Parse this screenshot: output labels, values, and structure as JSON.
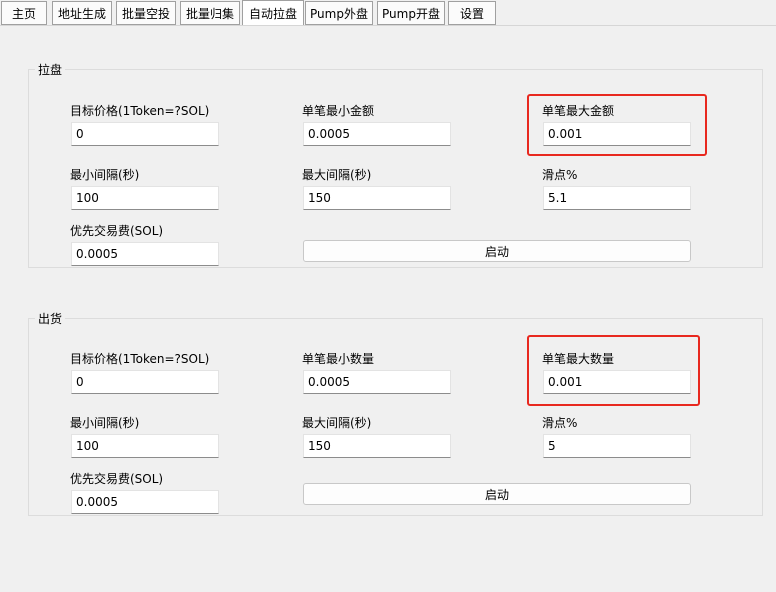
{
  "tabs": [
    "主页",
    "地址生成",
    "批量空投",
    "批量归集",
    "自动拉盘",
    "Pump外盘",
    "Pump开盘",
    "设置"
  ],
  "active_tab": "自动拉盘",
  "pump_group": {
    "title": "拉盘",
    "target_price_label": "目标价格(1Token=?SOL)",
    "target_price_value": "0",
    "min_amount_label": "单笔最小金额",
    "min_amount_value": "0.0005",
    "max_amount_label": "单笔最大金额",
    "max_amount_value": "0.001",
    "min_interval_label": "最小间隔(秒)",
    "min_interval_value": "100",
    "max_interval_label": "最大间隔(秒)",
    "max_interval_value": "150",
    "slippage_label": "滑点%",
    "slippage_value": "5.1",
    "priority_fee_label": "优先交易费(SOL)",
    "priority_fee_value": "0.0005",
    "start_button": "启动"
  },
  "sell_group": {
    "title": "出货",
    "target_price_label": "目标价格(1Token=?SOL)",
    "target_price_value": "0",
    "min_qty_label": "单笔最小数量",
    "min_qty_value": "0.0005",
    "max_qty_label": "单笔最大数量",
    "max_qty_value": "0.001",
    "min_interval_label": "最小间隔(秒)",
    "min_interval_value": "100",
    "max_interval_label": "最大间隔(秒)",
    "max_interval_value": "150",
    "slippage_label": "滑点%",
    "slippage_value": "5",
    "priority_fee_label": "优先交易费(SOL)",
    "priority_fee_value": "0.0005",
    "start_button": "启动"
  },
  "highlight_color": "#e8281f"
}
